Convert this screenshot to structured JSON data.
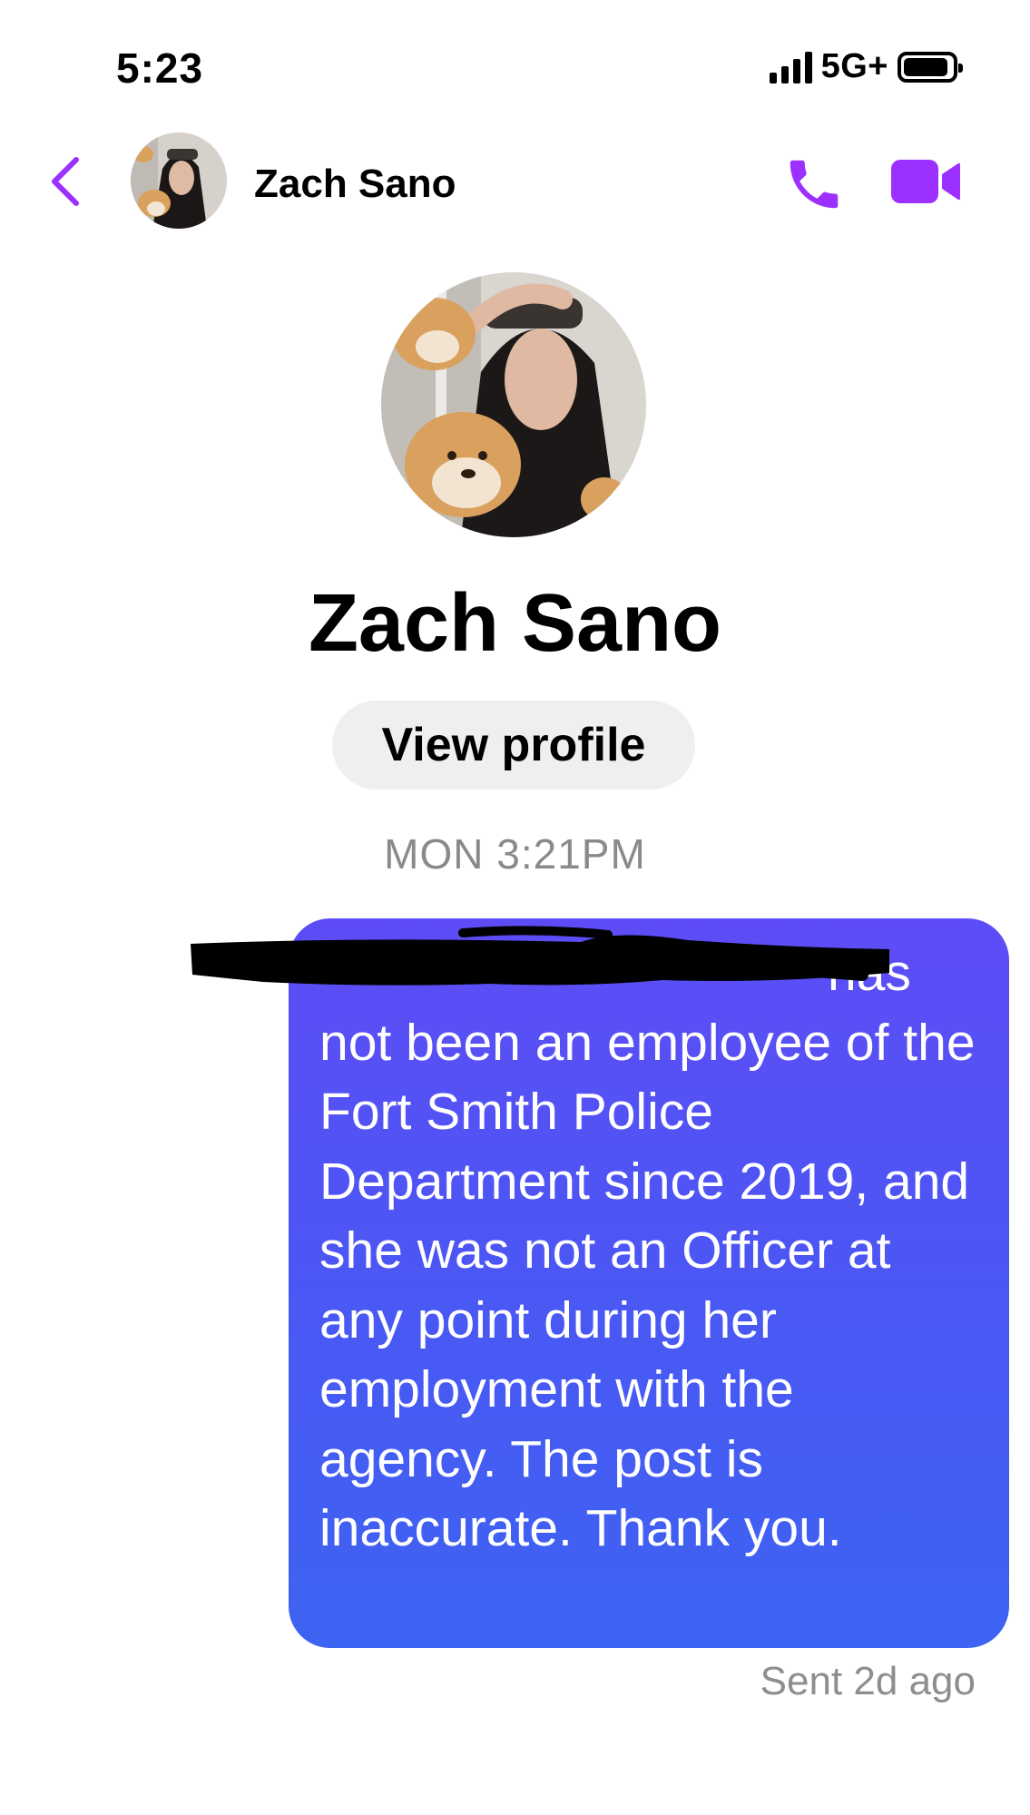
{
  "status_bar": {
    "time": "5:23",
    "network": "5G+"
  },
  "header": {
    "name": "Zach Sano",
    "icons": [
      "back-chevron-icon",
      "phone-icon",
      "video-camera-icon"
    ]
  },
  "profile": {
    "name": "Zach Sano",
    "view_profile_label": "View profile"
  },
  "thread": {
    "timestamp": "MON 3:21PM",
    "message_text": "has not been an employee of the Fort Smith Police Department since 2019, and she was not an Officer at any point during her employment with the agency. The post is inaccurate. Thank you.",
    "sent_status": "Sent 2d ago"
  },
  "colors": {
    "accent": "#9b30ff",
    "bubble_top": "#5d4cf6",
    "bubble_bottom": "#3d63f2"
  }
}
